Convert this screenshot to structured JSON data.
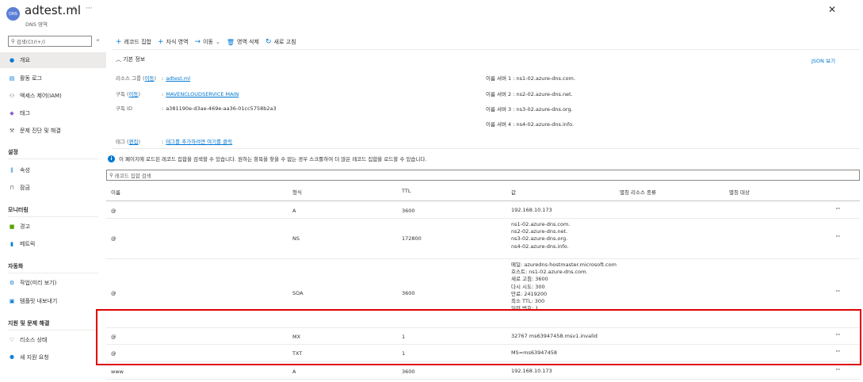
{
  "header": {
    "avatar": "DNS",
    "title": "adtest.ml",
    "subtitle": "DNS 영역",
    "pin_icon": "pin-icon",
    "more_icon": "ellipsis-icon",
    "close": "✕"
  },
  "sidebar": {
    "search_placeholder": "검색(Ctrl+/)",
    "collapse": "«",
    "items": [
      {
        "label": "개요",
        "icon": "overview-icon",
        "active": true
      },
      {
        "label": "활동 로그",
        "icon": "activity-log-icon"
      },
      {
        "label": "액세스 제어(IAM)",
        "icon": "iam-icon"
      },
      {
        "label": "태그",
        "icon": "tag-icon"
      },
      {
        "label": "문제 진단 및 해결",
        "icon": "wrench-icon"
      }
    ],
    "sections": [
      {
        "title": "설정",
        "items": [
          {
            "label": "속성",
            "icon": "properties-icon"
          },
          {
            "label": "잠금",
            "icon": "lock-icon"
          }
        ]
      },
      {
        "title": "모니터링",
        "items": [
          {
            "label": "경고",
            "icon": "alert-icon"
          },
          {
            "label": "메트릭",
            "icon": "metrics-icon"
          }
        ]
      },
      {
        "title": "자동화",
        "items": [
          {
            "label": "작업(미리 보기)",
            "icon": "tasks-icon"
          },
          {
            "label": "템플릿 내보내기",
            "icon": "export-template-icon"
          }
        ]
      },
      {
        "title": "지원 및 문제 해결",
        "items": [
          {
            "label": "리소스 상태",
            "icon": "heart-icon"
          },
          {
            "label": "새 지원 요청",
            "icon": "support-icon"
          }
        ]
      }
    ]
  },
  "toolbar": {
    "record_set": "레코드 집합",
    "child_zone": "자식 영역",
    "move": "이동",
    "delete_zone": "영역 삭제",
    "refresh": "새로 고침"
  },
  "essentials": {
    "title": "기본 정보",
    "json_view": "JSON 보기",
    "resource_group_label": "리소스 그룹",
    "resource_group_move": "이동",
    "resource_group_value": "adtest.ml",
    "subscription_label": "구독",
    "subscription_move": "이동",
    "subscription_value": "MAVENCLOUDSERVICE MAIN",
    "subscription_id_label": "구독 ID",
    "subscription_id_value": "a381190e-d3ae-469e-aa36-01cc5758b2a3",
    "tags_label": "태그",
    "tags_edit": "편집",
    "tags_value": "태그를 추가하려면 여기를 클릭",
    "name_servers": [
      {
        "label": "이름 서버 1",
        "value": "ns1-02.azure-dns.com."
      },
      {
        "label": "이름 서버 2",
        "value": "ns2-02.azure-dns.net."
      },
      {
        "label": "이름 서버 3",
        "value": "ns3-02.azure-dns.org."
      },
      {
        "label": "이름 서버 4",
        "value": "ns4-02.azure-dns.info."
      }
    ]
  },
  "info_message": "이 페이지에 로드된 레코드 집합을 검색할 수 있습니다. 원하는 항목을 찾을 수 없는 경우 스크롤하여 더 많은 레코드 집합을 로드할 수 있습니다.",
  "filter_placeholder": "레코드 집합 검색",
  "table": {
    "headers": [
      "이름",
      "형식",
      "TTL",
      "값",
      "별칭 리소스 종류",
      "별칭 대상"
    ],
    "rows": [
      {
        "name": "@",
        "type": "A",
        "ttl": "3600",
        "values": [
          "192.168.10.173"
        ]
      },
      {
        "name": "@",
        "type": "NS",
        "ttl": "172800",
        "values": [
          "ns1-02.azure-dns.com.",
          "ns2-02.azure-dns.net.",
          "ns3-02.azure-dns.org.",
          "ns4-02.azure-dns.info."
        ]
      },
      {
        "name": "@",
        "type": "SOA",
        "ttl": "3600",
        "values": [
          "메일: azuredns-hostmaster.microsoft.com",
          "호스트: ns1-02.azure-dns.com.",
          "새로 고침: 3600",
          "다시 시도: 300",
          "만료: 2419200",
          "최소 TTL: 300",
          "일련 번호: 1"
        ]
      },
      {
        "name": "@",
        "type": "MX",
        "ttl": "1",
        "values": [
          "32767 ms63947458.msv1.invalid"
        ]
      },
      {
        "name": "@",
        "type": "TXT",
        "ttl": "1",
        "values": [
          "MS=ms63947458"
        ]
      },
      {
        "name": "www",
        "type": "A",
        "ttl": "3600",
        "values": [
          "192.168.10.173"
        ]
      }
    ],
    "more": "···"
  },
  "colors": {
    "accent": "#0078d4",
    "highlight": "#e00000"
  }
}
